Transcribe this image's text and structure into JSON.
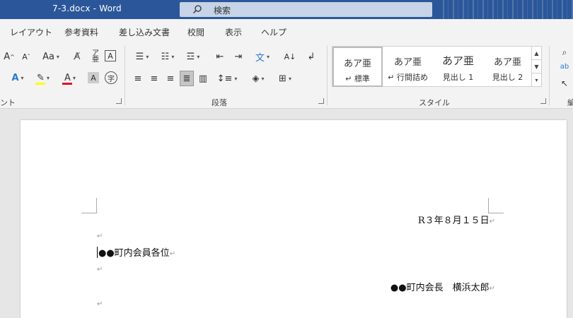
{
  "titlebar": {
    "title": "7-3.docx  -  Word",
    "search_label": "検索"
  },
  "tabs": [
    "レイアウト",
    "参考資料",
    "差し込み文書",
    "校閲",
    "表示",
    "ヘルプ"
  ],
  "ribbon": {
    "font_group": {
      "label": "ント",
      "grow_font": "A",
      "shrink_font": "A",
      "change_case": "Aa",
      "highlight_color": "#ffff00",
      "font_color": "#e81123"
    },
    "paragraph_group": {
      "label": "段落"
    },
    "styles_group": {
      "label": "スタイル",
      "styles": [
        {
          "sample": "あア亜",
          "name": "標準",
          "prefix": "↵"
        },
        {
          "sample": "あア亜",
          "name": "行間詰め",
          "prefix": "↵"
        },
        {
          "sample": "あア亜",
          "name": "見出し 1",
          "prefix": ""
        },
        {
          "sample": "あア亜",
          "name": "見出し 2",
          "prefix": ""
        }
      ]
    },
    "editing_group": {
      "label": "編"
    }
  },
  "document": {
    "paragraphs": [
      {
        "text": "R３年８月１５日",
        "align": "right"
      },
      {
        "text": "",
        "align": "left"
      },
      {
        "text": "●●町内会員各位",
        "align": "left"
      },
      {
        "text": "",
        "align": "left"
      },
      {
        "text": "●●町内会長　横浜太郎",
        "align": "right"
      },
      {
        "text": "",
        "align": "left"
      }
    ],
    "para_mark": "↵"
  }
}
